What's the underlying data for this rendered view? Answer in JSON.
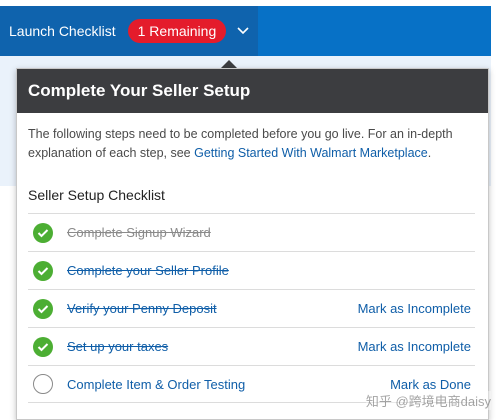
{
  "topbar": {
    "launch_label": "Launch Checklist",
    "remaining_badge": "1 Remaining"
  },
  "panel": {
    "title": "Complete Your Seller Setup",
    "intro_text": "The following steps need to be completed before you go live. For an in-depth explanation of each step, see ",
    "intro_link": "Getting Started With Walmart Marketplace",
    "intro_end": ".",
    "section_title": "Seller Setup Checklist",
    "items": [
      {
        "label": "Complete Signup Wizard",
        "done": true,
        "action": ""
      },
      {
        "label": "Complete your Seller Profile",
        "done": true,
        "action": ""
      },
      {
        "label": "Verify your Penny Deposit",
        "done": true,
        "action": "Mark as Incomplete"
      },
      {
        "label": "Set up your taxes",
        "done": true,
        "action": "Mark as Incomplete"
      },
      {
        "label": "Complete Item & Order Testing",
        "done": false,
        "action": "Mark as Done"
      }
    ]
  },
  "watermark": "知乎 @跨境电商daisy",
  "colors": {
    "topbar_blue": "#0771c6",
    "badge_red": "#e41c2b",
    "header_dark": "#3c3d40",
    "check_green": "#4cae33",
    "link_blue": "#0f5ea8"
  },
  "icons": {
    "chevron": "chevron-down-icon",
    "done": "checkmark-circle-icon",
    "pending": "empty-circle-icon"
  }
}
